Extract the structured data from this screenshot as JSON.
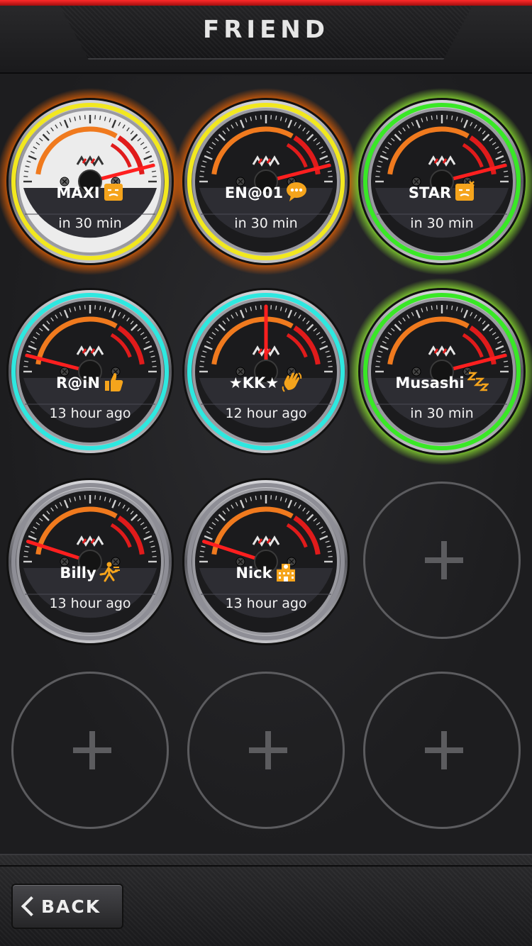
{
  "header": {
    "title": "FRIEND"
  },
  "friends": [
    {
      "name": "MAXI",
      "status_icon": "face-icon",
      "time": "in 30 min",
      "ring": "#f2e81f",
      "glow": "#ff6a00",
      "face": "white",
      "needle_level": 0.92
    },
    {
      "name": "EN@01",
      "status_icon": "chat-bubble-icon",
      "time": "in 30 min",
      "ring": "#f2e81f",
      "glow": "#ff6a00",
      "face": "dark",
      "needle_level": 0.92
    },
    {
      "name": "STAR",
      "status_icon": "angry-face-icon",
      "time": "in 30 min",
      "ring": "#39e826",
      "glow": "#9cff33",
      "face": "dark",
      "needle_level": 0.92
    },
    {
      "name": "R@iN",
      "status_icon": "thumbs-up-icon",
      "time": "13 hour ago",
      "ring": "#2ee8e0",
      "glow": "",
      "face": "dark",
      "needle_level": 0.08
    },
    {
      "name": "★KK★",
      "status_icon": "waving-hand-icon",
      "time": "12 hour ago",
      "ring": "#2ee8e0",
      "glow": "",
      "face": "dark",
      "needle_level": 0.5
    },
    {
      "name": "Musashi",
      "status_icon": "sleeping-zzz-icon",
      "time": "in 30 min",
      "ring": "#39e826",
      "glow": "#9cff33",
      "face": "dark",
      "needle_level": 0.92
    },
    {
      "name": "Billy",
      "status_icon": "running-man-icon",
      "time": "13 hour ago",
      "ring": "#8e8e96",
      "glow": "",
      "face": "dark",
      "needle_level": 0.1
    },
    {
      "name": "Nick",
      "status_icon": "school-building-icon",
      "time": "13 hour ago",
      "ring": "#8e8e96",
      "glow": "",
      "face": "dark",
      "needle_level": 0.1
    }
  ],
  "empty_slots": [
    {
      "icon": "plus-icon"
    },
    {
      "icon": "plus-icon"
    },
    {
      "icon": "plus-icon"
    },
    {
      "icon": "plus-icon"
    }
  ],
  "footer": {
    "back_label": "BACK"
  },
  "colors": {
    "accent_red": "#e01b1b",
    "arc_orange": "#f07a1e",
    "icon_orange": "#f5a41c"
  }
}
